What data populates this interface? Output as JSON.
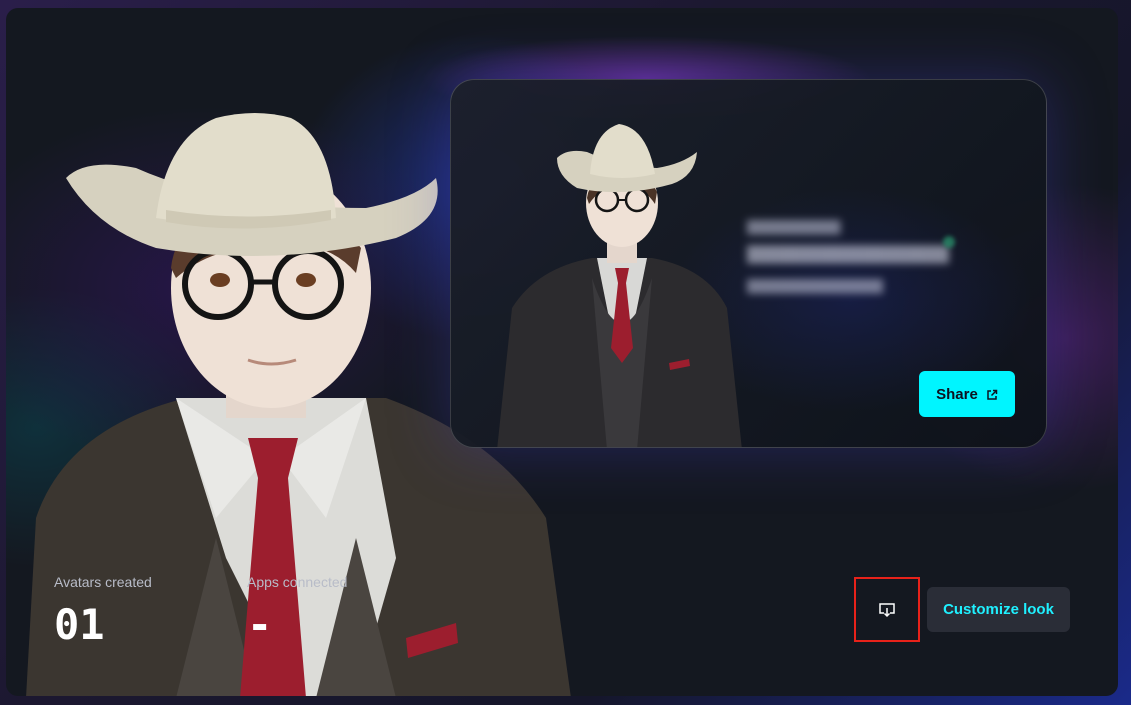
{
  "stats": [
    {
      "label": "Avatars created",
      "value": "01"
    },
    {
      "label": "Apps connected",
      "value": "-"
    }
  ],
  "card": {
    "share_label": "Share",
    "share_icon": "external-link-icon"
  },
  "actions": {
    "download_icon": "download-icon",
    "customize_label": "Customize look"
  },
  "colors": {
    "accent_cyan": "#00f5ff",
    "highlight_red": "#e8221a",
    "frame_bg": "#141820"
  }
}
